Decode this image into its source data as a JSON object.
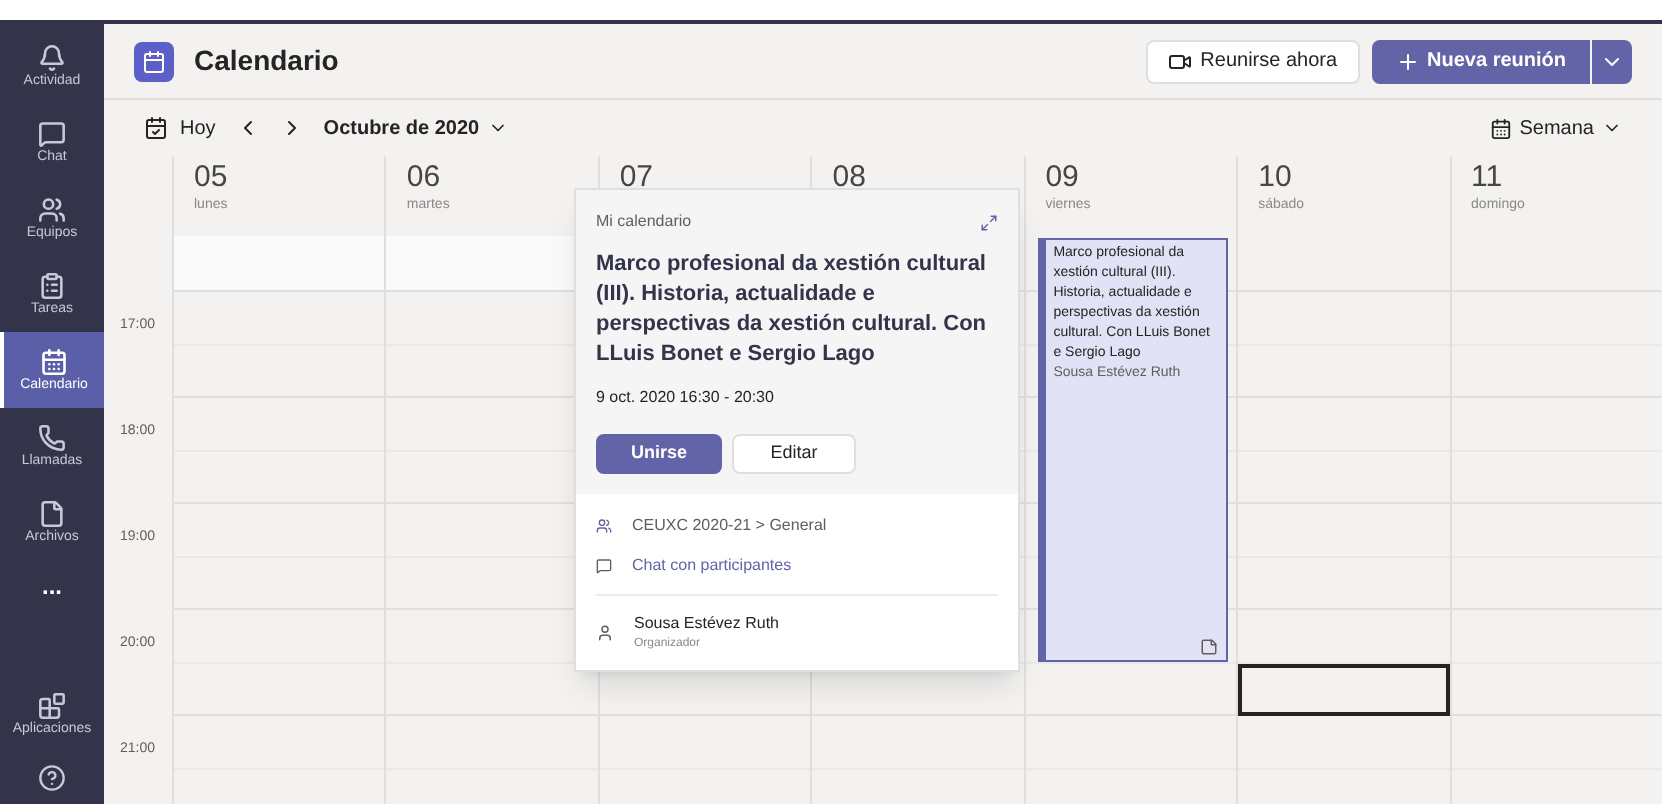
{
  "sidebar": {
    "items": [
      {
        "label": "Actividad",
        "selected": false
      },
      {
        "label": "Chat",
        "selected": false
      },
      {
        "label": "Equipos",
        "selected": false
      },
      {
        "label": "Tareas",
        "selected": false
      },
      {
        "label": "Calendario",
        "selected": true
      },
      {
        "label": "Llamadas",
        "selected": false
      },
      {
        "label": "Archivos",
        "selected": false
      }
    ],
    "more": "...",
    "bottom_items": [
      {
        "label": "Aplicaciones",
        "selected": false
      }
    ]
  },
  "header": {
    "title": "Calendario",
    "meet_now": "Reunirse ahora",
    "new_meeting": "Nueva reunión"
  },
  "toolbar": {
    "today": "Hoy",
    "month": "Octubre de 2020",
    "view": "Semana"
  },
  "times": [
    "17:00",
    "18:00",
    "19:00",
    "20:00",
    "21:00"
  ],
  "days": [
    {
      "number": "05",
      "name": "lunes",
      "slot_selected": false
    },
    {
      "number": "06",
      "name": "martes",
      "slot_selected": false
    },
    {
      "number": "07",
      "slot_selected": false
    },
    {
      "number": "08",
      "slot_selected": false
    },
    {
      "number": "09",
      "name": "viernes",
      "slot_selected": false,
      "events": [
        {
          "title": "Marco profesional da xestión cultural (III). Historia, actualidade e perspectivas da xestión cultural. Con LLuis Bonet e Sergio Lago",
          "organizer": "Sousa Estévez Ruth",
          "selected": true
        }
      ]
    },
    {
      "number": "10",
      "name": "sábado",
      "slot_selected": true
    },
    {
      "number": "11",
      "name": "domingo",
      "slot_selected": false
    }
  ],
  "popup": {
    "calendar": "Mi calendario",
    "title": "Marco profesional da xestión cultural (III). Historia, actualidade e perspectivas da xestión cultural. Con LLuis Bonet e Sergio Lago",
    "when": "9 oct. 2020 16:30 - 20:30",
    "join": "Unirse",
    "edit": "Editar",
    "channel": "CEUXC 2020-21 > General",
    "chat": "Chat con participantes",
    "organizer": "Sousa Estévez Ruth",
    "role": "Organizador"
  }
}
